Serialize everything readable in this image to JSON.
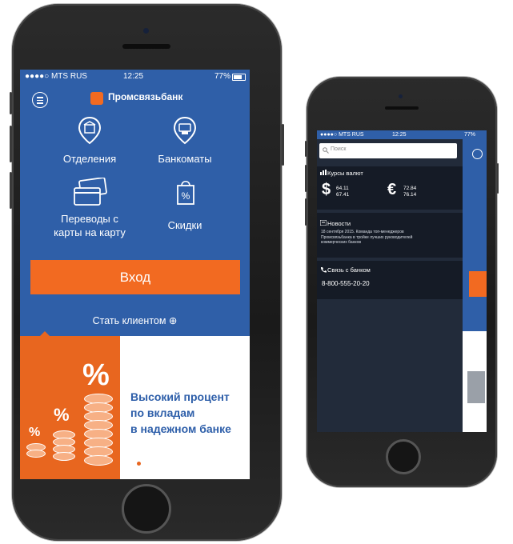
{
  "left_phone": {
    "status": {
      "carrier": "●●●●○ MTS RUS",
      "time": "12:25",
      "battery": "77%"
    },
    "brand": "Промсвязьбанк",
    "menu": [
      {
        "label": "Отделения",
        "icon": "map-pin-bank-icon"
      },
      {
        "label": "Банкоматы",
        "icon": "map-pin-atm-icon"
      },
      {
        "label_line1": "Переводы с",
        "label_line2": "карты на карту",
        "icon": "cards-transfer-icon"
      },
      {
        "label": "Скидки",
        "icon": "shopping-bag-percent-icon"
      }
    ],
    "login_label": "Вход",
    "become_client": "Стать клиентом ⊕",
    "banner": {
      "line1": "Высокий процент",
      "line2": "по вкладам",
      "line3": "в надежном банке",
      "pct": "%"
    },
    "colors": {
      "primary": "#2f5fa8",
      "accent": "#f26a21"
    }
  },
  "right_phone": {
    "status": {
      "carrier": "●●●●○ MTS RUS",
      "time": "12:25",
      "battery": "77%"
    },
    "search_placeholder": "Поиск",
    "rates_title": "Курсы валют",
    "usd_symbol": "$",
    "usd_buy": "64.11",
    "usd_sell": "67.41",
    "eur_symbol": "€",
    "eur_buy": "72.84",
    "eur_sell": "76.14",
    "news_title": "Новости",
    "news_line1": "18 сентября 2015. Команда топ-менеджеров",
    "news_line2": "Промсвязьбанка в тройке лучших руководителей",
    "news_line3": "коммерческих банков",
    "contact_title": "Связь с банком",
    "phone_number": "8-800-555-20-20"
  }
}
